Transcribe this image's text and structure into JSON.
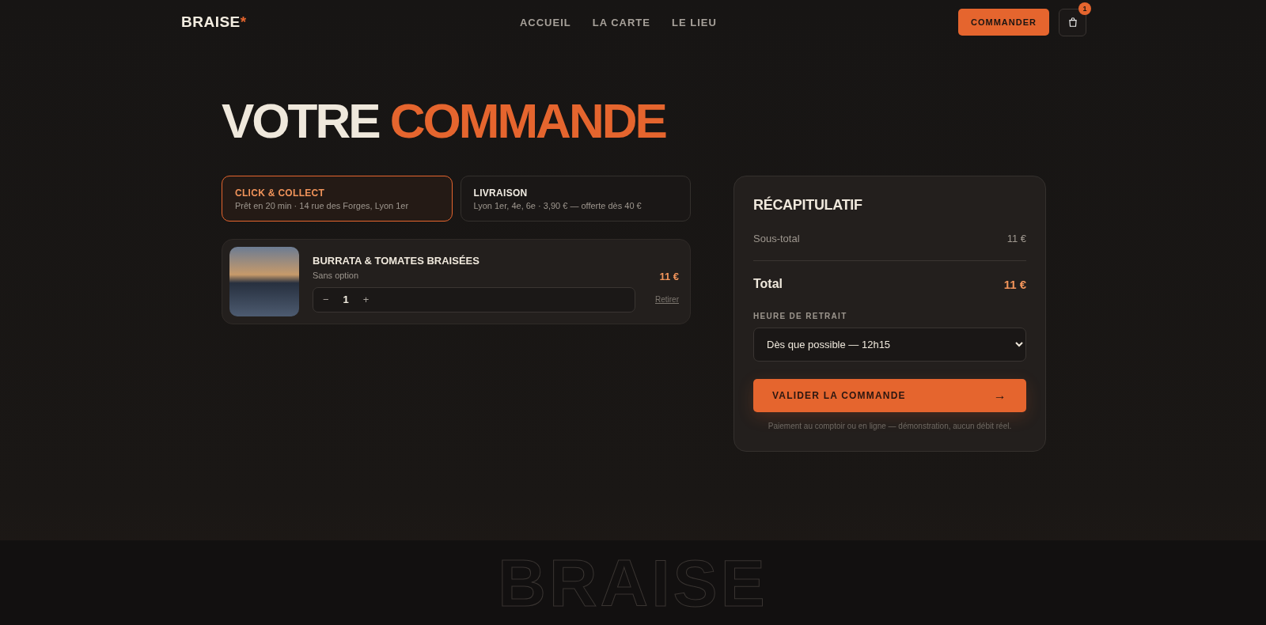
{
  "header": {
    "logo": "BRAISE",
    "logo_mark": "*",
    "nav": [
      {
        "label": "ACCUEIL"
      },
      {
        "label": "LA CARTE"
      },
      {
        "label": "LE LIEU"
      }
    ],
    "cta": "COMMANDER",
    "cart_count": "1"
  },
  "title": {
    "first": "VOTRE",
    "accent": "COMMANDE"
  },
  "modes": [
    {
      "title": "CLICK & COLLECT",
      "detail": "Prêt en 20 min · 14 rue des Forges, Lyon 1er",
      "selected": true
    },
    {
      "title": "LIVRAISON",
      "detail": "Lyon 1er, 4e, 6e · 3,90 € — offerte dès 40 €",
      "selected": false
    }
  ],
  "items": [
    {
      "name": "BURRATA & TOMATES BRAISÉES",
      "option": "Sans option",
      "minus": "−",
      "quantity": "1",
      "plus": "+",
      "price": "11 €",
      "remove": "Retirer"
    }
  ],
  "summary": {
    "title": "RÉCAPITULATIF",
    "subtotal_label": "Sous-total",
    "subtotal": "11 €",
    "total_label": "Total",
    "total": "11 €",
    "pickup_label": "HEURE DE RETRAIT",
    "pickup_value": "Dès que possible — 12h15",
    "submit": "VALIDER LA COMMANDE",
    "submit_arrow": "→",
    "note": "Paiement au comptoir ou en ligne — démonstration, aucun débit réel."
  },
  "footer": {
    "wordmark": "BRAISE"
  }
}
